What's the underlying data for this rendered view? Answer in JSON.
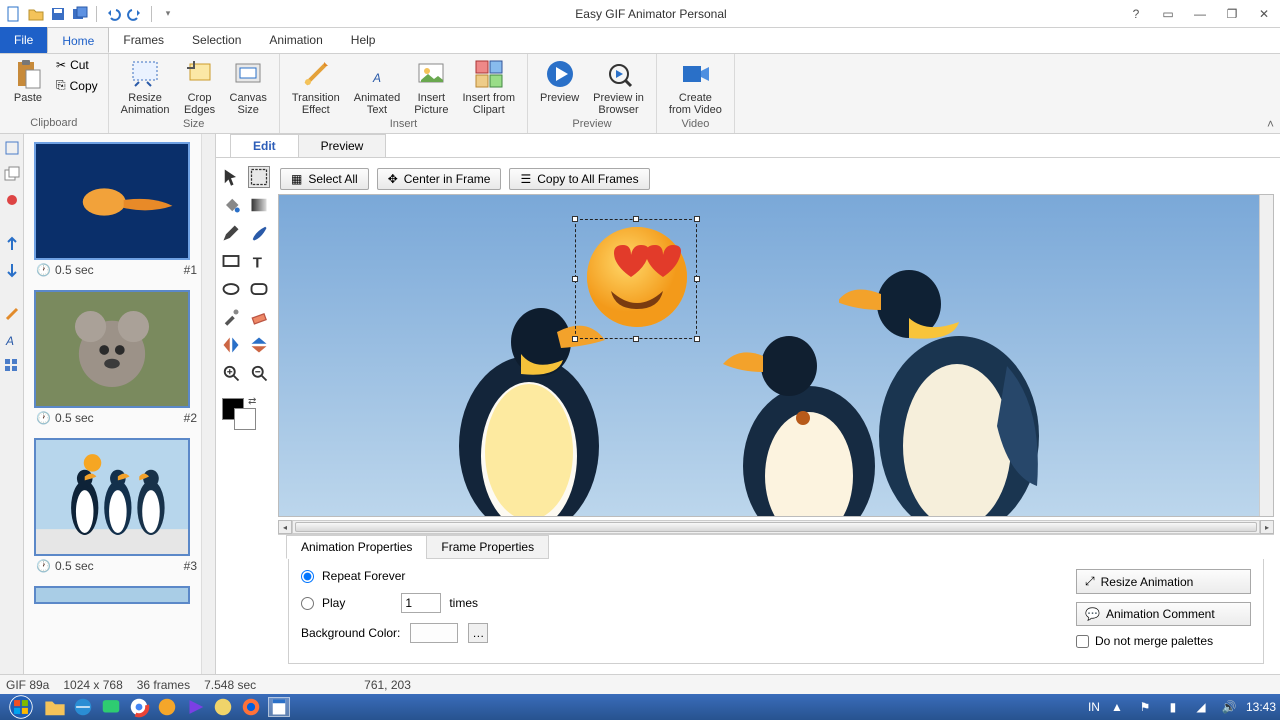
{
  "app": {
    "title": "Easy GIF Animator Personal"
  },
  "qat": [
    "new",
    "open",
    "save",
    "saveas",
    "undo",
    "redo"
  ],
  "wincontrols": {
    "help": "?",
    "options": "▭",
    "min": "—",
    "max": "❐",
    "close": "✕"
  },
  "menu_file": "File",
  "menu_tabs": [
    "Home",
    "Frames",
    "Selection",
    "Animation",
    "Help"
  ],
  "menu_active": "Home",
  "ribbon": {
    "clipboard": {
      "label": "Clipboard",
      "paste": "Paste",
      "cut": "Cut",
      "copy": "Copy"
    },
    "size": {
      "label": "Size",
      "resize": "Resize\nAnimation",
      "crop": "Crop\nEdges",
      "canvas": "Canvas\nSize"
    },
    "insert": {
      "label": "Insert",
      "transition": "Transition\nEffect",
      "animtext": "Animated\nText",
      "picture": "Insert\nPicture",
      "clipart": "Insert from\nClipart"
    },
    "preview": {
      "label": "Preview",
      "preview": "Preview",
      "browser": "Preview in\nBrowser"
    },
    "video": {
      "label": "Video",
      "create": "Create\nfrom Video"
    }
  },
  "frames": [
    {
      "duration": "0.5 sec",
      "index": "#1"
    },
    {
      "duration": "0.5 sec",
      "index": "#2"
    },
    {
      "duration": "0.5 sec",
      "index": "#3"
    }
  ],
  "edit": {
    "tabs": [
      "Edit",
      "Preview"
    ],
    "active": "Edit",
    "actions": {
      "selectAll": "Select All",
      "center": "Center in Frame",
      "copyAll": "Copy to All Frames"
    }
  },
  "props": {
    "tabs": [
      "Animation Properties",
      "Frame Properties"
    ],
    "active": "Animation Properties",
    "repeatForever": "Repeat Forever",
    "play": "Play",
    "playTimes": "1",
    "timesLabel": "times",
    "bgLabel": "Background Color:",
    "resizeBtn": "Resize Animation",
    "commentBtn": "Animation Comment",
    "noMerge": "Do not merge palettes"
  },
  "status": {
    "format": "GIF 89a",
    "dims": "1024 x 768",
    "frames": "36 frames",
    "duration": "7.548 sec",
    "cursor": "761,  203"
  },
  "taskbar": {
    "clock": "13:43",
    "lang": "IN"
  }
}
